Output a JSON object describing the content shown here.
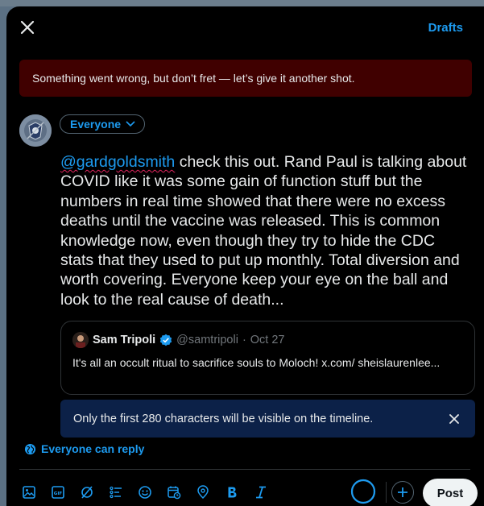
{
  "header": {
    "drafts_label": "Drafts"
  },
  "error_banner": {
    "text": "Something went wrong, but don’t fret — let’s give it another shot."
  },
  "composer": {
    "audience_label": "Everyone",
    "mention": "@gardgoldsmith",
    "body": " check this out. Rand Paul is talking about COVID like it was some gain of function stuff but the numbers in real time showed that there were no excess deaths until the vaccine was released. This is common knowledge now, even though they try to hide the CDC stats that they used to put up monthly. Total diversion and worth covering. Everyone keep your eye on the ball and look to the real cause of death..."
  },
  "quote": {
    "name": "Sam Tripoli",
    "handle": "@samtripoli",
    "dot": "·",
    "date": "Oct 27",
    "text": "It's all an occult ritual to sacrifice souls to Moloch! x.com/ sheislaurenlee..."
  },
  "warning": {
    "text": "Only the first 280 characters will be visible on the timeline."
  },
  "reply_setting": {
    "label": "Everyone can reply"
  },
  "toolbar": {
    "icons": [
      "image-icon",
      "gif-icon",
      "grok-icon",
      "poll-icon",
      "emoji-icon",
      "schedule-icon",
      "location-icon",
      "bold-icon",
      "italic-icon"
    ],
    "post_label": "Post",
    "character_limit_progress": 1.0
  },
  "colors": {
    "accent": "#1d9bf0",
    "error_bg": "#400000",
    "warning_bg": "#0c2148",
    "background": "#000000"
  }
}
